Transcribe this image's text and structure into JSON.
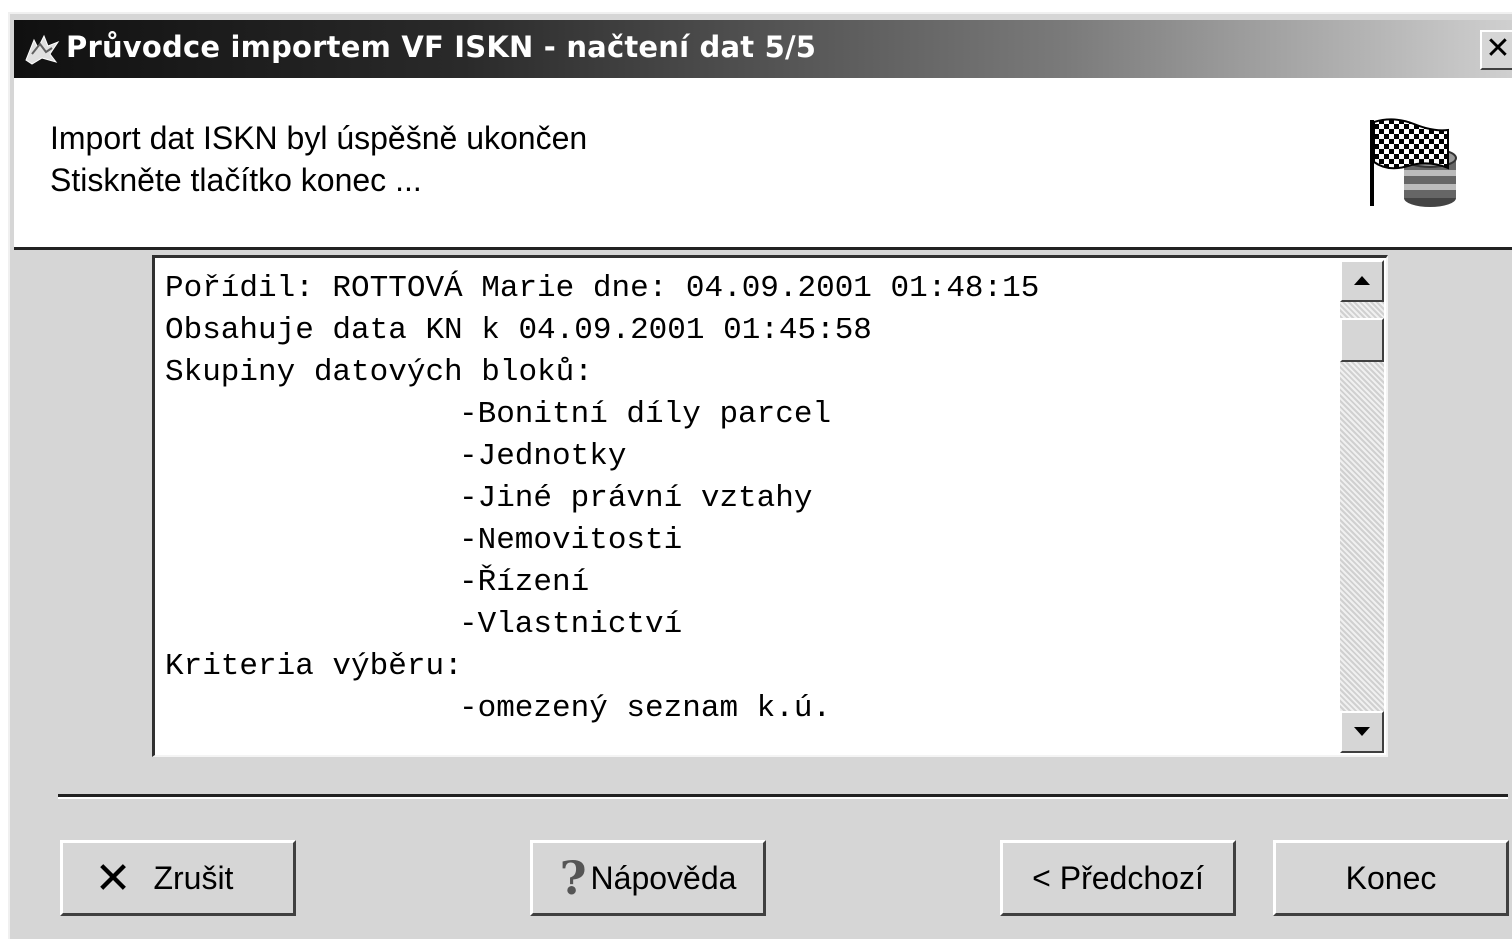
{
  "window": {
    "title": "Průvodce importem VF ISKN - načtení dat 5/5",
    "close_symbol": "✕"
  },
  "header": {
    "line1": "Import dat ISKN byl úspěšně ukončen",
    "line2": "Stiskněte tlačítko konec ...",
    "icon": "checkered-flag-database-icon"
  },
  "log": {
    "lines": [
      {
        "text": "Pořídil: ROTTOVÁ Marie dne: 04.09.2001 01:48:15",
        "indent": false
      },
      {
        "text": "Obsahuje data KN k 04.09.2001 01:45:58",
        "indent": false
      },
      {
        "text": "Skupiny datových bloků:",
        "indent": false
      },
      {
        "text": "-Bonitní díly parcel",
        "indent": true
      },
      {
        "text": "-Jednotky",
        "indent": true
      },
      {
        "text": "-Jiné právní vztahy",
        "indent": true
      },
      {
        "text": "-Nemovitosti",
        "indent": true
      },
      {
        "text": "-Řízení",
        "indent": true
      },
      {
        "text": "-Vlastnictví",
        "indent": true
      },
      {
        "text": "Kriteria výběru:",
        "indent": false
      },
      {
        "text": "-omezený seznam k.ú.",
        "indent": true
      }
    ]
  },
  "buttons": {
    "cancel_icon": "✕",
    "cancel": "Zrušit",
    "help_icon": "?",
    "help": "Nápověda",
    "previous": "< Předchozí",
    "finish": "Konec"
  },
  "colors": {
    "face": "#d6d6d6",
    "title_dark": "#101010"
  }
}
